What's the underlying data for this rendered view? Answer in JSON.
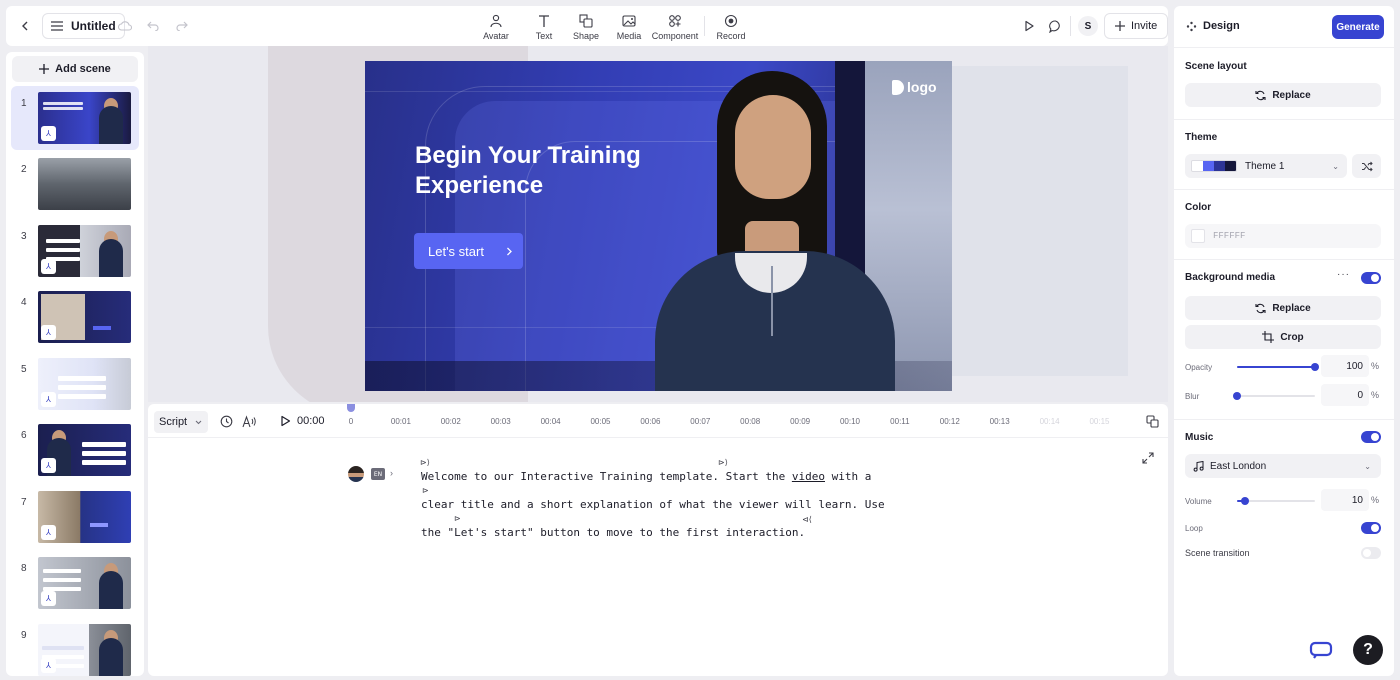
{
  "toolbar": {
    "doc_title": "Untitled",
    "tools": [
      {
        "label": "Avatar",
        "icon": "avatar-icon"
      },
      {
        "label": "Text",
        "icon": "text-icon"
      },
      {
        "label": "Shape",
        "icon": "shape-icon"
      },
      {
        "label": "Media",
        "icon": "media-icon"
      },
      {
        "label": "Component",
        "icon": "component-icon"
      },
      {
        "label": "Record",
        "icon": "record-icon"
      }
    ],
    "user_initial": "S",
    "invite_label": "Invite"
  },
  "scenes": {
    "add_label": "Add scene",
    "items": [
      {
        "number": "1",
        "thumb_title": "Begin Your Training Experience"
      },
      {
        "number": "2"
      },
      {
        "number": "3"
      },
      {
        "number": "4"
      },
      {
        "number": "5"
      },
      {
        "number": "6"
      },
      {
        "number": "7"
      },
      {
        "number": "8"
      },
      {
        "number": "9"
      }
    ]
  },
  "slide": {
    "title": "Begin Your Training Experience",
    "cta_label": "Let's start",
    "logo_text": "logo"
  },
  "timeline": {
    "mode_label": "Script",
    "current_time": "00:00",
    "ticks": [
      "0",
      "00:01",
      "00:02",
      "00:03",
      "00:04",
      "00:05",
      "00:06",
      "00:07",
      "00:08",
      "00:09",
      "00:10",
      "00:11",
      "00:12",
      "00:13",
      "00:14",
      "00:15"
    ]
  },
  "script": {
    "language": "EN",
    "line1_a": "Welcome to our Interactive Training template. Start the ",
    "line1_link": "video",
    "line1_b": " with a",
    "line2": "clear title and a short explanation of what the viewer will learn. Use",
    "line3": "the \"Let's start\" button to move to the first interaction."
  },
  "design_panel": {
    "title": "Design",
    "generate_label": "Generate",
    "scene_layout": {
      "label": "Scene layout",
      "button": "Replace"
    },
    "theme": {
      "label": "Theme",
      "value": "Theme 1",
      "swatch_colors": [
        "#ffffff",
        "#5865f2",
        "#2d3496",
        "#14163a"
      ]
    },
    "color": {
      "label": "Color",
      "value": "FFFFFF"
    },
    "background_media": {
      "label": "Background media",
      "enabled": true,
      "replace_label": "Replace",
      "crop_label": "Crop",
      "opacity_label": "Opacity",
      "opacity_value": "100",
      "opacity_fraction": 1.0,
      "blur_label": "Blur",
      "blur_value": "0",
      "blur_fraction": 0.0,
      "unit": "%"
    },
    "music": {
      "label": "Music",
      "enabled": true,
      "track": "East London",
      "volume_label": "Volume",
      "volume_value": "10",
      "volume_fraction": 0.1,
      "unit": "%",
      "loop_label": "Loop",
      "loop_enabled": true
    },
    "scene_transition": {
      "label": "Scene transition",
      "enabled": false
    }
  },
  "colors": {
    "accent": "#3744d1",
    "slide_bg": "#2d3496",
    "cta": "#5865f2"
  }
}
